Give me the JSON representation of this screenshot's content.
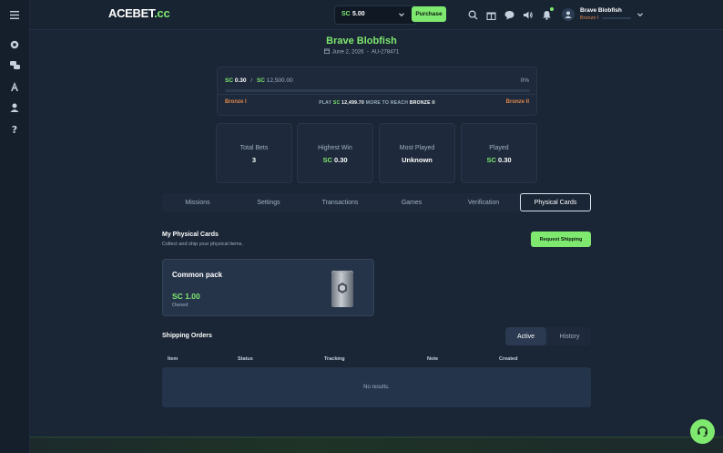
{
  "brand": {
    "logo_a": "ACEBET",
    "logo_b": ".cc"
  },
  "topbar": {
    "balance_currency": "SC",
    "balance_value": "5.00",
    "purchase_label": "Purchase",
    "user_name": "Brave Blobfish",
    "user_rank": "Bronze I"
  },
  "profile": {
    "name": "Brave Blobfish",
    "joined": "June 2, 2026",
    "separator": "-",
    "id": "AU-278471"
  },
  "progress": {
    "currency": "SC",
    "current": "0.30",
    "slash": "/",
    "target": "12,500.00",
    "percent_label": "0%",
    "fill_fraction": 0.0,
    "from_rank": "Bronze I",
    "to_rank": "Bronze II",
    "msg_play": "PLAY",
    "msg_amount": "12,499.70",
    "msg_more": "MORE TO REACH",
    "msg_rank": "BRONZE II"
  },
  "stats": {
    "total_bets": {
      "label": "Total Bets",
      "value": "3"
    },
    "highest_win": {
      "label": "Highest Win",
      "currency": "SC",
      "value": "0.30"
    },
    "most_played": {
      "label": "Most Played",
      "value": "Unknown"
    },
    "played": {
      "label": "Played",
      "currency": "SC",
      "value": "0.30"
    }
  },
  "tabs": [
    "Missions",
    "Settings",
    "Transactions",
    "Games",
    "Verification",
    "Physical Cards"
  ],
  "physical_cards": {
    "title": "My Physical Cards",
    "subtitle": "Collect and ship your physical items.",
    "request_label": "Request Shipping",
    "pack": {
      "name": "Common pack",
      "currency": "SC",
      "value": "1.00",
      "owned_label": "Owned"
    }
  },
  "shipping": {
    "title": "Shipping Orders",
    "toggle_active": "Active",
    "toggle_history": "History",
    "columns": [
      "Item",
      "Status",
      "Tracking",
      "Note",
      "Created"
    ],
    "empty": "No results."
  },
  "colors": {
    "accent": "#7ee86f",
    "rank": "#e0864a",
    "background": "#1a2535"
  }
}
